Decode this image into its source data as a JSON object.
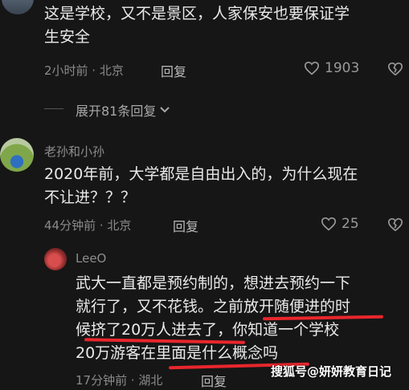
{
  "comments": [
    {
      "text_line1": "这是学校，又不是景区，人家保安也要保证学",
      "text_line2": "生安全",
      "time_location": "2小时前 · 北京",
      "reply_label": "回复",
      "like_count": "1903",
      "expand_label": "展开81条回复"
    },
    {
      "username": "老孙和小孙",
      "text_line1": "2020年前，大学都是自由出入的，为什么现在",
      "text_line2": "不让进？？？",
      "time_location": "44分钟前 · 北京",
      "reply_label": "回复",
      "like_count": "25"
    }
  ],
  "reply": {
    "username": "LeeO",
    "text_line1": "武大一直都是预约制的，想进去预约一下",
    "text_line2": "就行了，又不花钱。之前放开随便进的时",
    "text_line3": "候挤了20万人进去了，你知道一个学校",
    "text_line4": "20万游客在里面是什么概念吗",
    "time_location": "17分钟前 · 湖北",
    "reply_label": "回复"
  },
  "watermark": "搜狐号@妍妍教育日记",
  "colors": {
    "background": "#161616",
    "underline": "#e8262d"
  }
}
